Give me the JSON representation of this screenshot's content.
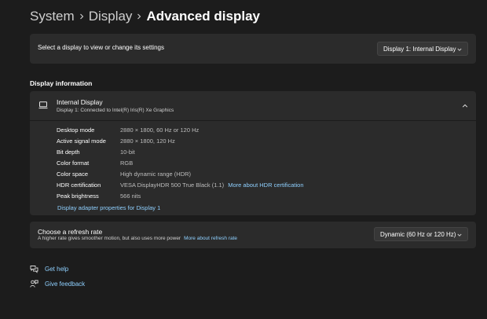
{
  "breadcrumb": {
    "items": [
      "System",
      "Display"
    ],
    "current": "Advanced display"
  },
  "select_display": {
    "label": "Select a display to view or change its settings",
    "selected": "Display 1: Internal Display"
  },
  "display_information": {
    "section_title": "Display information",
    "title": "Internal Display",
    "subtitle": "Display 1: Connected to Intel(R) Iris(R) Xe Graphics",
    "properties": [
      {
        "key": "Desktop mode",
        "value": "2880 × 1800, 60 Hz or 120 Hz"
      },
      {
        "key": "Active signal mode",
        "value": "2880 × 1800, 120 Hz"
      },
      {
        "key": "Bit depth",
        "value": "10-bit"
      },
      {
        "key": "Color format",
        "value": "RGB"
      },
      {
        "key": "Color space",
        "value": "High dynamic range (HDR)"
      },
      {
        "key": "HDR certification",
        "value": "VESA DisplayHDR 500 True Black (1.1)",
        "link": "More about HDR certification"
      },
      {
        "key": "Peak brightness",
        "value": "566 nits"
      }
    ],
    "adapter_link": "Display adapter properties for Display 1"
  },
  "refresh_rate": {
    "title": "Choose a refresh rate",
    "subtitle": "A higher rate gives smoother motion, but also uses more power",
    "link": "More about refresh rate",
    "selected": "Dynamic (60 Hz or 120 Hz)"
  },
  "help": {
    "get_help": "Get help",
    "give_feedback": "Give feedback"
  },
  "colors": {
    "background": "#1c1c1c",
    "card": "#2b2b2b",
    "link": "#8fd0ff"
  },
  "icons": [
    "chevron-right-icon",
    "chevron-down-icon",
    "chevron-up-icon",
    "monitor-icon",
    "help-icon",
    "feedback-icon"
  ]
}
